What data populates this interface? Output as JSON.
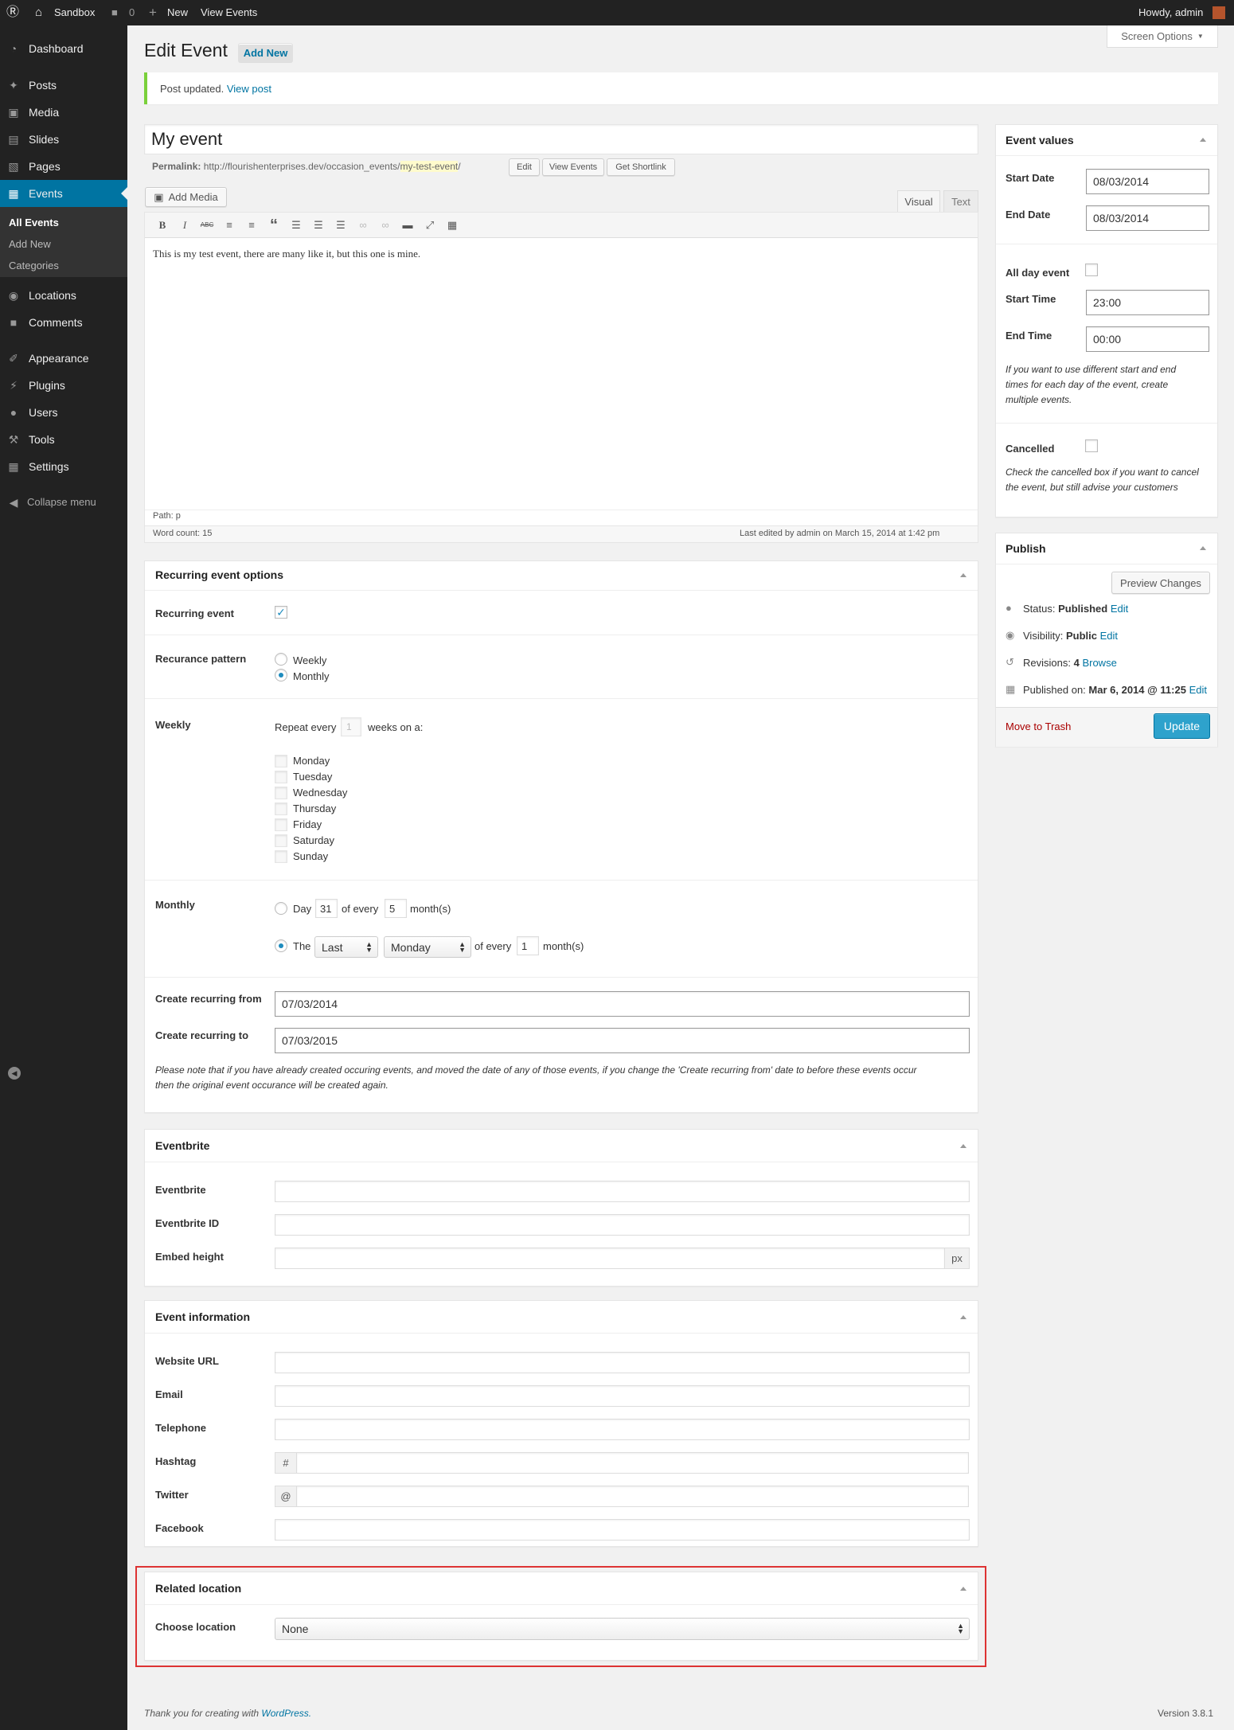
{
  "admin_bar": {
    "site_name": "Sandbox",
    "comments_count": "0",
    "new_label": "New",
    "view_events_label": "View Events",
    "greeting": "Howdy, admin"
  },
  "sidebar": {
    "items": [
      {
        "label": "Dashboard",
        "icon": "dashboard-icon"
      },
      {
        "label": "Posts",
        "icon": "pin-icon"
      },
      {
        "label": "Media",
        "icon": "media-icon"
      },
      {
        "label": "Slides",
        "icon": "slides-icon"
      },
      {
        "label": "Pages",
        "icon": "pages-icon"
      },
      {
        "label": "Events",
        "icon": "calendar-icon"
      },
      {
        "label": "Locations",
        "icon": "location-icon"
      },
      {
        "label": "Comments",
        "icon": "comment-icon"
      },
      {
        "label": "Appearance",
        "icon": "brush-icon"
      },
      {
        "label": "Plugins",
        "icon": "plug-icon"
      },
      {
        "label": "Users",
        "icon": "user-icon"
      },
      {
        "label": "Tools",
        "icon": "wrench-icon"
      },
      {
        "label": "Settings",
        "icon": "settings-icon"
      }
    ],
    "submenu": [
      "All Events",
      "Add New",
      "Categories"
    ],
    "collapse_label": "Collapse menu"
  },
  "header": {
    "title": "Edit Event",
    "add_new_label": "Add New",
    "screen_options_label": "Screen Options"
  },
  "notice": {
    "text": "Post updated.",
    "link": "View post"
  },
  "editor": {
    "post_title": "My event",
    "permalink_label": "Permalink:",
    "permalink_base": "http://flourishenterprises.dev/occasion_events/",
    "permalink_slug": "my-test-event",
    "permalink_end": "/",
    "edit_label": "Edit",
    "view_events_label": "View Events",
    "shortlink_label": "Get Shortlink",
    "add_media_label": "Add Media",
    "visual_tab": "Visual",
    "text_tab": "Text",
    "content": "This is my test event, there are many like it, but this one is mine.",
    "path": "Path: p",
    "word_count": "Word count: 15",
    "last_edited": "Last edited by admin on March 15, 2014 at 1:42 pm"
  },
  "recurring": {
    "title": "Recurring event options",
    "recurring_label": "Recurring event",
    "recurring_checked": true,
    "pattern_label": "Recurance pattern",
    "pattern_options": [
      "Weekly",
      "Monthly"
    ],
    "pattern_selected": "Monthly",
    "weekly_label": "Weekly",
    "repeat_every": "Repeat every",
    "repeat_value": "1",
    "weeks_on": "weeks on a:",
    "days": [
      "Monday",
      "Tuesday",
      "Wednesday",
      "Thursday",
      "Friday",
      "Saturday",
      "Sunday"
    ],
    "monthly_label": "Monthly",
    "day_label": "Day",
    "day_value": "31",
    "of_every": "of every",
    "month_value_1": "5",
    "months_label": "month(s)",
    "the_label": "The",
    "ordinal_value": "Last",
    "weekday_value": "Monday",
    "month_value_2": "1",
    "from_label": "Create recurring from",
    "from_value": "07/03/2014",
    "to_label": "Create recurring to",
    "to_value": "07/03/2015",
    "note_line1": "Please note that if you have already created occuring events, and moved the date of any of those events, if you change the 'Create recurring from' date to before these events occur",
    "note_line2": "then the original event occurance will be created again."
  },
  "eventbrite": {
    "title": "Eventbrite",
    "fields": [
      "Eventbrite",
      "Eventbrite ID",
      "Embed height"
    ],
    "unit": "px"
  },
  "event_info": {
    "title": "Event information",
    "fields": [
      "Website URL",
      "Email",
      "Telephone",
      "Hashtag",
      "Twitter",
      "Facebook"
    ],
    "hashtag_prefix": "#",
    "twitter_prefix": "@"
  },
  "related_location": {
    "title": "Related location",
    "label": "Choose location",
    "value": "None",
    "highlight_color": "#dd3333"
  },
  "event_values": {
    "title": "Event values",
    "start_date_label": "Start Date",
    "start_date": "08/03/2014",
    "end_date_label": "End Date",
    "end_date": "08/03/2014",
    "all_day_label": "All day event",
    "start_time_label": "Start Time",
    "start_time": "23:00",
    "end_time_label": "End Time",
    "end_time": "00:00",
    "time_note_1": "If you want to use different start and end",
    "time_note_2": "times for each day of the event, create",
    "time_note_3": "multiple events.",
    "cancelled_label": "Cancelled",
    "cancel_note_1": "Check the cancelled box if you want to cancel",
    "cancel_note_2": "the event, but still advise your customers"
  },
  "publish": {
    "title": "Publish",
    "preview_label": "Preview Changes",
    "status_label": "Status:",
    "status_value": "Published",
    "visibility_label": "Visibility:",
    "visibility_value": "Public",
    "revisions_label": "Revisions:",
    "revisions_value": "4",
    "browse_label": "Browse",
    "published_label": "Published on:",
    "published_value": "Mar 6, 2014 @ 11:25",
    "edit_label": "Edit",
    "trash_label": "Move to Trash",
    "update_label": "Update"
  },
  "footer": {
    "thanks": "Thank you for creating with",
    "wp_link": "WordPress.",
    "version": "Version 3.8.1"
  }
}
